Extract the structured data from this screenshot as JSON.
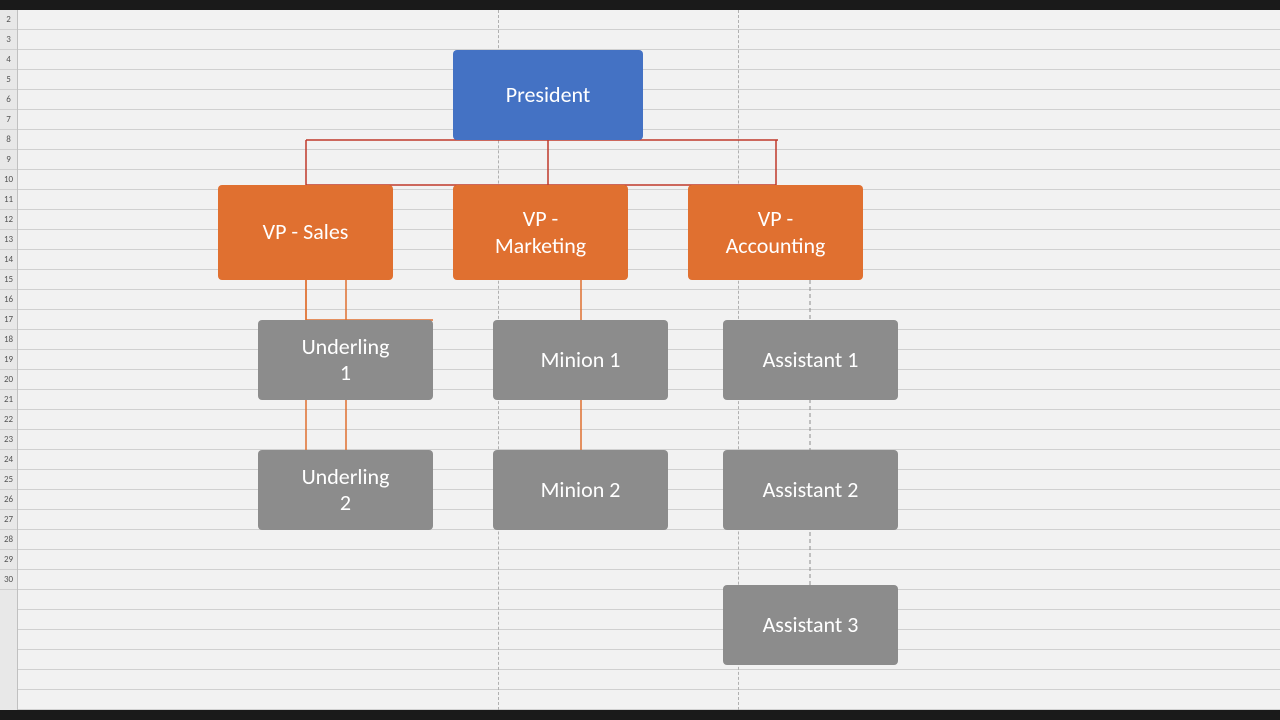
{
  "spreadsheet": {
    "background_color": "#f2f2f2",
    "grid_line_color": "#d0d0d0"
  },
  "rows": [
    "2",
    "3",
    "4",
    "5",
    "6",
    "7",
    "8",
    "9",
    "10",
    "11",
    "12",
    "13",
    "14",
    "15",
    "16",
    "17",
    "18",
    "19",
    "20",
    "21",
    "22",
    "23",
    "24",
    "25",
    "26",
    "27",
    "28",
    "29",
    "30"
  ],
  "chart": {
    "president": {
      "label": "President",
      "color": "#4472c4"
    },
    "vp_sales": {
      "label": "VP - Sales",
      "color": "#e07030"
    },
    "vp_marketing": {
      "label": "VP -\nMarketing",
      "color": "#e07030"
    },
    "vp_accounting": {
      "label": "VP -\nAccounting",
      "color": "#e07030"
    },
    "underling1": {
      "label": "Underling\n1",
      "color": "#8c8c8c"
    },
    "underling2": {
      "label": "Underling\n2",
      "color": "#8c8c8c"
    },
    "minion1": {
      "label": "Minion 1",
      "color": "#8c8c8c"
    },
    "minion2": {
      "label": "Minion 2",
      "color": "#8c8c8c"
    },
    "assistant1": {
      "label": "Assistant 1",
      "color": "#8c8c8c"
    },
    "assistant2": {
      "label": "Assistant 2",
      "color": "#8c8c8c"
    },
    "assistant3": {
      "label": "Assistant 3",
      "color": "#8c8c8c"
    }
  }
}
